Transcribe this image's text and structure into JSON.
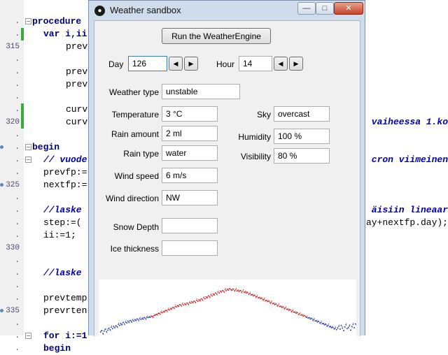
{
  "editor": {
    "gutter": [
      {
        "text": ".",
        "line": 0
      },
      {
        "text": ".",
        "line": 1
      },
      {
        "text": "315",
        "line": 2
      },
      {
        "text": ".",
        "line": 3
      },
      {
        "text": ".",
        "line": 4
      },
      {
        "text": ".",
        "line": 5
      },
      {
        "text": ".",
        "line": 6
      },
      {
        "text": ".",
        "line": 7
      },
      {
        "text": "320",
        "line": 8
      },
      {
        "text": ".",
        "line": 9
      },
      {
        "text": ".",
        "line": 10
      },
      {
        "text": ".",
        "line": 11
      },
      {
        "text": ".",
        "line": 12
      },
      {
        "text": "325",
        "line": 13
      },
      {
        "text": ".",
        "line": 14
      },
      {
        "text": ".",
        "line": 15
      },
      {
        "text": ".",
        "line": 16
      },
      {
        "text": ".",
        "line": 17
      },
      {
        "text": "330",
        "line": 18
      },
      {
        "text": ".",
        "line": 19
      },
      {
        "text": ".",
        "line": 20
      },
      {
        "text": ".",
        "line": 21
      },
      {
        "text": ".",
        "line": 22
      },
      {
        "text": "335",
        "line": 23
      },
      {
        "text": ".",
        "line": 24
      },
      {
        "text": ".",
        "line": 25
      },
      {
        "text": ".",
        "line": 26
      }
    ],
    "lines": [
      {
        "line": 0,
        "text": "procedure",
        "style": "kw",
        "indent": 0
      },
      {
        "line": 1,
        "text": "var i,ii",
        "style": "kw",
        "indent": 2
      },
      {
        "line": 2,
        "text": "prevf",
        "style": "",
        "indent": 6
      },
      {
        "line": 4,
        "text": "prevf",
        "style": "",
        "indent": 6
      },
      {
        "line": 5,
        "text": "prevf",
        "style": "",
        "indent": 6
      },
      {
        "line": 7,
        "text": "curvf",
        "style": "",
        "indent": 6
      },
      {
        "line": 8,
        "text": "curvf",
        "style": "",
        "indent": 6
      },
      {
        "line": 10,
        "text": "begin",
        "style": "kw",
        "indent": 0
      },
      {
        "line": 11,
        "text": "// vuode",
        "style": "cm",
        "indent": 2
      },
      {
        "line": 12,
        "text": "prevfp:=",
        "style": "",
        "indent": 2
      },
      {
        "line": 13,
        "text": "nextfp:=",
        "style": "",
        "indent": 2
      },
      {
        "line": 15,
        "text": "//laske",
        "style": "cm",
        "indent": 2
      },
      {
        "line": 16,
        "text": "step:=(",
        "style": "",
        "indent": 2
      },
      {
        "line": 17,
        "text": "ii:=1;",
        "style": "",
        "indent": 2
      },
      {
        "line": 20,
        "text": "//laske",
        "style": "cm",
        "indent": 2
      },
      {
        "line": 22,
        "text": "prevtemp",
        "style": "",
        "indent": 2
      },
      {
        "line": 23,
        "text": "prevrten",
        "style": "",
        "indent": 2
      },
      {
        "line": 25,
        "text": "for i:=1",
        "style": "kw",
        "indent": 2
      },
      {
        "line": 26,
        "text": "begin",
        "style": "kw",
        "indent": 2
      }
    ],
    "right_fragments": [
      {
        "line": 8,
        "text": "vaiheessa 1.ko",
        "style": "cm"
      },
      {
        "line": 11,
        "text": "cron viimeinen",
        "style": "cm"
      },
      {
        "line": 15,
        "text": "äisiin lineaar",
        "style": "cm"
      },
      {
        "line": 16,
        "text": "ay+nextfp.day);",
        "style": "nm"
      }
    ]
  },
  "dialog": {
    "title": "Weather sandbox",
    "icon": "paw-icon",
    "run_button": "Run the WeatherEngine",
    "day": {
      "label": "Day",
      "value": "126"
    },
    "hour": {
      "label": "Hour",
      "value": "14"
    },
    "weather_type": {
      "label": "Weather type",
      "value": "unstable"
    },
    "temperature": {
      "label": "Temperature",
      "value": "3 °C"
    },
    "rain_amount": {
      "label": "Rain amount",
      "value": "2 ml"
    },
    "rain_type": {
      "label": "Rain type",
      "value": "water"
    },
    "wind_speed": {
      "label": "Wind speed",
      "value": "6 m/s"
    },
    "wind_direction": {
      "label": "Wind direction",
      "value": "NW"
    },
    "snow_depth": {
      "label": "Snow Depth",
      "value": ""
    },
    "ice_thickness": {
      "label": "Ice thickness",
      "value": ""
    },
    "sky": {
      "label": "Sky",
      "value": "overcast"
    },
    "humidity": {
      "label": "Humidity",
      "value": "100 %"
    },
    "visibility": {
      "label": "Visibility",
      "value": "80 %"
    }
  },
  "colors": {
    "code_keyword": "#000080",
    "code_comment": "#0000b0",
    "modified_bar": "#3aaa3a",
    "plot_cold": "#1c2fa0",
    "plot_warm": "#c01818"
  },
  "chart_data": {
    "type": "scatter",
    "series": [
      {
        "values": [
          -3.2,
          -2.9,
          -3.5,
          -3.0,
          -2.6,
          -3.1,
          -2.8,
          -2.4,
          -2.7,
          -2.2,
          -2.5,
          -2.0,
          -2.3,
          -1.9,
          -2.1,
          -1.6,
          -1.8,
          -1.4,
          -1.7,
          -1.2,
          -1.5,
          -1.1,
          -1.3,
          -0.9,
          -1.2,
          -0.8,
          -1.0,
          -0.7,
          -0.9,
          -0.6,
          -0.8,
          -0.5,
          -0.7,
          -0.4,
          -0.6,
          -0.3,
          -0.5,
          -0.2,
          -0.4,
          -0.1,
          -0.2,
          0.0,
          -0.1,
          0.1,
          0.0,
          0.2,
          0.3,
          0.5,
          0.4,
          0.7,
          0.6,
          0.9,
          0.8,
          1.1,
          1.0,
          1.3,
          1.2,
          1.5,
          1.4,
          1.7,
          1.6,
          1.9,
          1.8,
          2.1,
          2.0,
          2.3,
          2.2,
          2.5,
          2.3,
          2.6,
          2.4,
          2.7,
          2.5,
          2.8,
          2.6,
          2.9,
          2.8,
          3.1,
          2.9,
          3.2,
          3.0,
          3.4,
          3.2,
          3.5,
          3.3,
          3.7,
          3.5,
          3.9,
          3.7,
          4.1,
          3.9,
          4.3,
          4.1,
          4.5,
          4.3,
          4.7,
          4.5,
          4.9,
          4.7,
          5.1,
          4.9,
          5.3,
          5.1,
          5.4,
          5.2,
          5.6,
          5.4,
          5.7,
          5.5,
          5.8,
          5.6,
          5.5,
          5.7,
          5.4,
          5.6,
          5.3,
          5.5,
          5.2,
          5.4,
          5.1,
          5.3,
          5.0,
          5.2,
          4.9,
          5.0,
          4.7,
          4.8,
          4.5,
          4.6,
          4.3,
          4.4,
          4.1,
          4.2,
          3.9,
          4.0,
          3.7,
          3.8,
          3.5,
          3.6,
          3.3,
          3.4,
          3.1,
          3.2,
          2.9,
          3.0,
          2.7,
          2.8,
          2.5,
          2.6,
          2.3,
          2.4,
          2.1,
          2.2,
          1.9,
          2.0,
          1.7,
          1.8,
          1.5,
          1.6,
          1.3,
          1.4,
          1.1,
          1.2,
          0.9,
          1.0,
          0.7,
          0.8,
          0.5,
          0.6,
          0.3,
          0.4,
          0.1,
          0.2,
          0.0,
          -0.1,
          -0.3,
          -0.2,
          -0.5,
          -0.4,
          -0.7,
          -0.6,
          -0.9,
          -0.8,
          -1.1,
          -1.0,
          -1.3,
          -1.2,
          -1.5,
          -1.4,
          -1.7,
          -1.6,
          -1.9,
          -1.8,
          -2.1,
          -2.0,
          -2.3,
          -2.2,
          -2.5,
          -2.4,
          -2.7,
          -2.3,
          -2.0,
          -2.6,
          -1.8,
          -2.4,
          -2.9,
          -2.1,
          -1.7,
          -2.5,
          -2.2,
          -1.9,
          -2.8,
          -2.0,
          -1.6,
          -2.3,
          -1.5
        ]
      }
    ],
    "ylim": [
      -4,
      7
    ]
  }
}
